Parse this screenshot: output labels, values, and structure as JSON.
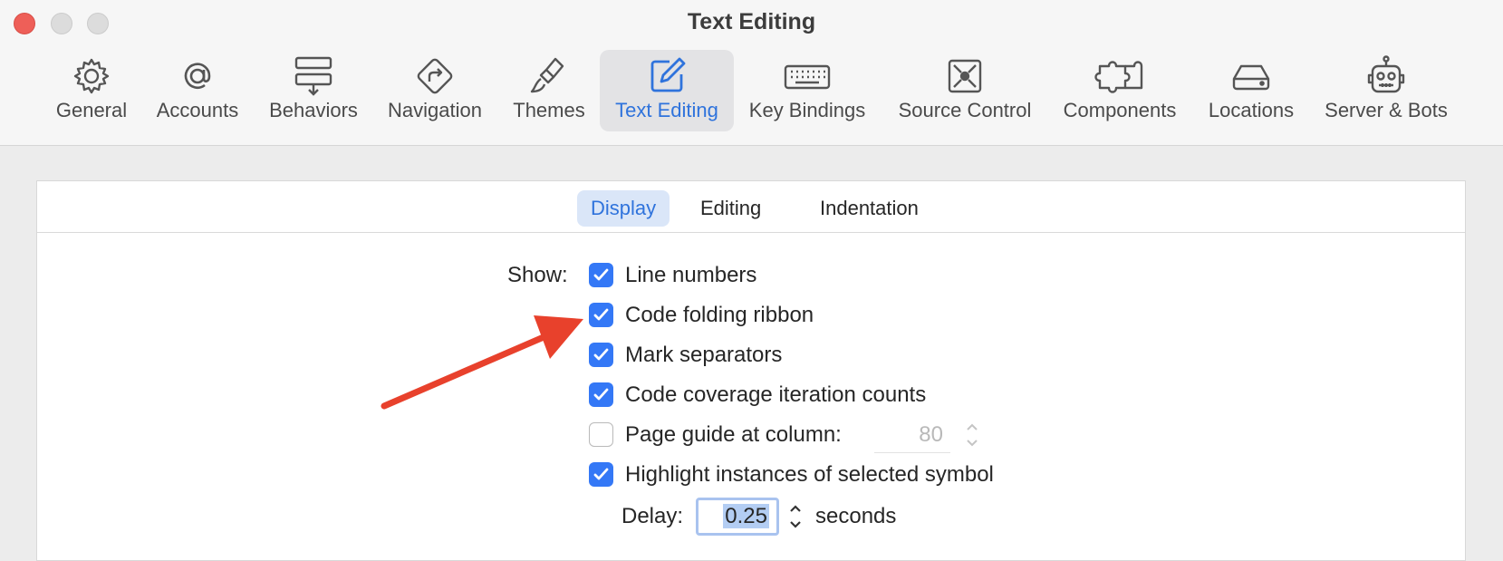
{
  "window": {
    "title": "Text Editing"
  },
  "toolbar": {
    "items": [
      {
        "label": "General",
        "icon": "gear-icon"
      },
      {
        "label": "Accounts",
        "icon": "at-sign-icon"
      },
      {
        "label": "Behaviors",
        "icon": "behaviors-icon"
      },
      {
        "label": "Navigation",
        "icon": "navigation-arrow-icon"
      },
      {
        "label": "Themes",
        "icon": "paintbrush-icon"
      },
      {
        "label": "Text Editing",
        "icon": "pencil-square-icon"
      },
      {
        "label": "Key Bindings",
        "icon": "keyboard-icon"
      },
      {
        "label": "Source Control",
        "icon": "source-control-icon"
      },
      {
        "label": "Components",
        "icon": "puzzle-icon"
      },
      {
        "label": "Locations",
        "icon": "drive-icon"
      },
      {
        "label": "Server & Bots",
        "icon": "robot-icon"
      }
    ],
    "selected": "Text Editing"
  },
  "tabs": {
    "items": [
      "Display",
      "Editing",
      "Indentation"
    ],
    "selected": "Display"
  },
  "display": {
    "show_label": "Show:",
    "options": [
      {
        "label": "Line numbers",
        "checked": true
      },
      {
        "label": "Code folding ribbon",
        "checked": true
      },
      {
        "label": "Mark separators",
        "checked": true
      },
      {
        "label": "Code coverage iteration counts",
        "checked": true
      },
      {
        "label": "Page guide at column:",
        "checked": false
      },
      {
        "label": "Highlight instances of selected symbol",
        "checked": true
      }
    ],
    "page_guide_column": "80",
    "delay_label": "Delay:",
    "delay_value": "0.25",
    "seconds_label": "seconds"
  },
  "colors": {
    "accent": "#3478f6",
    "annotation_arrow": "#e8412c"
  }
}
